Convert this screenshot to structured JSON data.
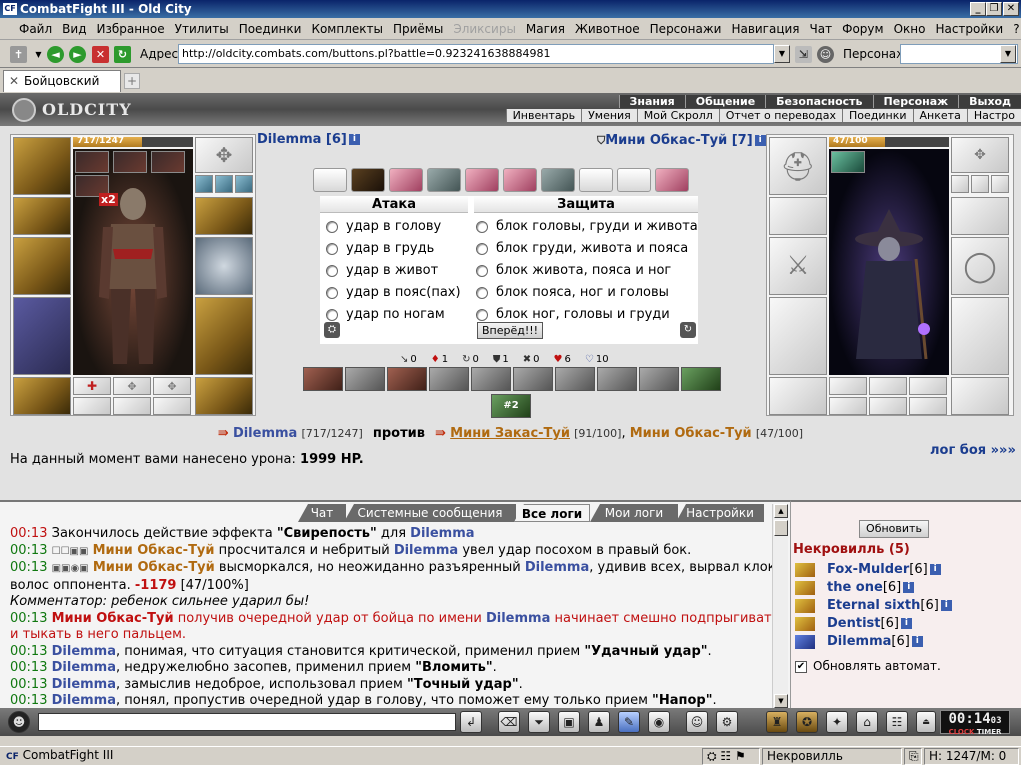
{
  "window": {
    "title": "CombatFight III - Old City",
    "app_icon": "CF",
    "controls": [
      "_",
      "❐",
      "✕"
    ]
  },
  "menu": [
    "Файл",
    "Вид",
    "Избранное",
    "Утилиты",
    "Поединки",
    "Комплекты",
    "Приёмы",
    "Эликсиры",
    "Магия",
    "Животное",
    "Персонажи",
    "Навигация",
    "Чат",
    "Форум",
    "Окно",
    "Настройки",
    "?"
  ],
  "menu_disabled": "Эликсиры",
  "address": {
    "label": "Адрес:",
    "url": "http://oldcity.combats.com/buttons.pl?battle=0.923241638884981",
    "character_label": "Персонаж:",
    "character_value": ""
  },
  "tab": {
    "title": "Бойцовский клуб",
    "new_tab": "+"
  },
  "game": {
    "logo": "OLDCITY",
    "top_nav": [
      "Знания",
      "Общение",
      "Безопасность",
      "Персонаж",
      "Выход"
    ],
    "sub_nav": [
      "Инвентарь",
      "Умения",
      "Мой Скролл",
      "Отчет о переводах",
      "Поединки",
      "Анкета",
      "Настро"
    ]
  },
  "player": {
    "name": "Dilemma",
    "level": "[6]",
    "hp_text": "717/1247",
    "hp_fraction": 0.575,
    "badge": "x2"
  },
  "enemy": {
    "name": "Мини Обкас-Туй",
    "level": "[7]",
    "hp_text": "47/100",
    "hp_fraction": 0.47
  },
  "combat": {
    "attack_header": "Атака",
    "defense_header": "Защита",
    "attacks": [
      "удар в голову",
      "удар в грудь",
      "удар в живот",
      "удар в пояс(пах)",
      "удар по ногам"
    ],
    "blocks": [
      "блок головы, груди и живота",
      "блок груди, живота и пояса",
      "блок живота, пояса и ног",
      "блок пояса, ног и головы",
      "блок ног, головы и груди"
    ],
    "go_button": "Вперёд!!!"
  },
  "stats": [
    {
      "icon": "↘",
      "value": "0"
    },
    {
      "icon": "♦",
      "value": "1"
    },
    {
      "icon": "↻",
      "value": "0"
    },
    {
      "icon": "⛊",
      "value": "1"
    },
    {
      "icon": "✖",
      "value": "0"
    },
    {
      "icon": "♥",
      "value": "6"
    },
    {
      "icon": "♡",
      "value": "10"
    }
  ],
  "skill_extra": "#2",
  "versus": {
    "p1": "Dilemma",
    "p1_hp": "[717/1247]",
    "vs": "против",
    "p2": "Мини Закас-Туй",
    "p2_hp": "[91/100]",
    "p3": "Мини Обкас-Туй",
    "p3_hp": "[47/100]"
  },
  "damage": {
    "text": "На данный момент вами нанесено урона:",
    "value": "1999 HP."
  },
  "log_link": "лог боя »»»",
  "log_tabs": [
    "Чат",
    "Системные сообщения",
    "Все логи",
    "Мои логи",
    "Настройки"
  ],
  "log_tab_active": "Все логи",
  "log": {
    "l1_time": "00:13",
    "l1_a": "Закончилось действие эффекта ",
    "l1_b": "\"Свирепость\"",
    "l1_c": " для ",
    "l1_name": "Dilemma",
    "l2_time": "00:13",
    "l2_icons": "☐☐▣▣",
    "l2_name": "Мини Обкас-Туй",
    "l2_a": " просчитался и небритый ",
    "l2_name2": "Dilemma",
    "l2_b": " увел удар посохом в правый бок.",
    "l3_time": "00:13",
    "l3_icons": "▣▣◉▣",
    "l3_name": "Мини Обкас-Туй",
    "l3_a": " высморкался, но неожиданно разъяренный ",
    "l3_name2": "Dilemma",
    "l3_b": ", удивив всех, вырвал клок волос оппонента. ",
    "l3_dmg": "-1179",
    "l3_c": " [47/100%]",
    "l4": "Комментатор: ребенок сильнее ударил бы!",
    "l5_time": "00:13",
    "l5_name": "Мини Обкас-Туй",
    "l5_a": " получив очередной удар от бойца по имени ",
    "l5_name2": "Dilemma",
    "l5_b": " начинает смешно подпрыгивать и тыкать в него пальцем.",
    "l6_time": "00:13",
    "l6_name": "Dilemma",
    "l6_a": ", понимая, что ситуация становится критической, применил прием ",
    "l6_b": "\"Удачный удар\"",
    "l6_c": ".",
    "l7_time": "00:13",
    "l7_name": "Dilemma",
    "l7_a": ", недружелюбно засопев, применил прием ",
    "l7_b": "\"Вломить\"",
    "l7_c": ".",
    "l8_time": "00:13",
    "l8_name": "Dilemma",
    "l8_a": ", замыслив недоброе, использовал прием ",
    "l8_b": "\"Точный удар\"",
    "l8_c": ".",
    "l9_time": "00:13",
    "l9_name": "Dilemma",
    "l9_a": ", понял, пропустив очередной удар в голову, что поможет ему только прием ",
    "l9_b": "\"Напор\"",
    "l9_c": "."
  },
  "room": {
    "refresh": "Обновить",
    "name": "Некровилль (5)",
    "players": [
      {
        "name": "Fox-Mulder",
        "level": "[6]"
      },
      {
        "name": "the one",
        "level": "[6]"
      },
      {
        "name": "Eternal sixth",
        "level": "[6]"
      },
      {
        "name": "Dentist",
        "level": "[6]"
      },
      {
        "name": "Dilemma",
        "level": "[6]"
      }
    ],
    "auto_refresh": "Обновлять автомат.",
    "auto_checked": true
  },
  "clock": {
    "time": "00:14",
    "seconds": "03",
    "label_a": "CLOCK",
    "label_b": "TIMER"
  },
  "status": {
    "app": "CombatFight III",
    "room": "Некровилль",
    "hp": "H: 1247/M: 0"
  }
}
